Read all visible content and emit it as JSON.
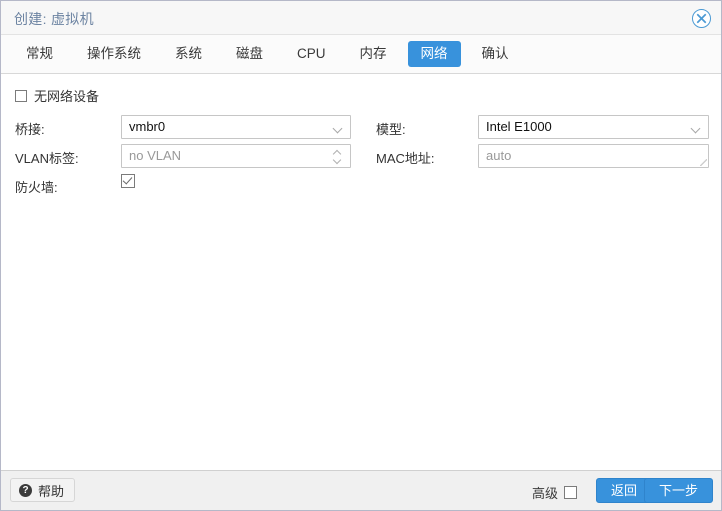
{
  "window": {
    "title": "创建: 虚拟机",
    "close_icon": "close-circle-icon"
  },
  "tabs": [
    {
      "label": "常规",
      "active": false
    },
    {
      "label": "操作系统",
      "active": false
    },
    {
      "label": "系统",
      "active": false
    },
    {
      "label": "磁盘",
      "active": false
    },
    {
      "label": "CPU",
      "active": false
    },
    {
      "label": "内存",
      "active": false
    },
    {
      "label": "网络",
      "active": true
    },
    {
      "label": "确认",
      "active": false
    }
  ],
  "form": {
    "no_network_device": {
      "label": "无网络设备",
      "checked": false
    },
    "bridge": {
      "label": "桥接:",
      "value": "vmbr0",
      "icon": "chevron-down-icon"
    },
    "vlan_tag": {
      "label": "VLAN标签:",
      "value": "no VLAN",
      "is_placeholder": true,
      "icon": "spinner-updown-icon"
    },
    "firewall": {
      "label": "防火墙:",
      "checked": true
    },
    "model": {
      "label": "模型:",
      "value": "Intel E1000",
      "icon": "chevron-down-icon"
    },
    "mac_address": {
      "label": "MAC地址:",
      "value": "auto",
      "is_placeholder": true
    }
  },
  "footer": {
    "help_label": "帮助",
    "help_icon": "question-mark-icon",
    "advanced_label": "高级",
    "advanced_checked": false,
    "back_label": "返回",
    "next_label": "下一步"
  },
  "colors": {
    "accent": "#3892dc",
    "title_text": "#6d84a2",
    "placeholder": "#999999"
  }
}
